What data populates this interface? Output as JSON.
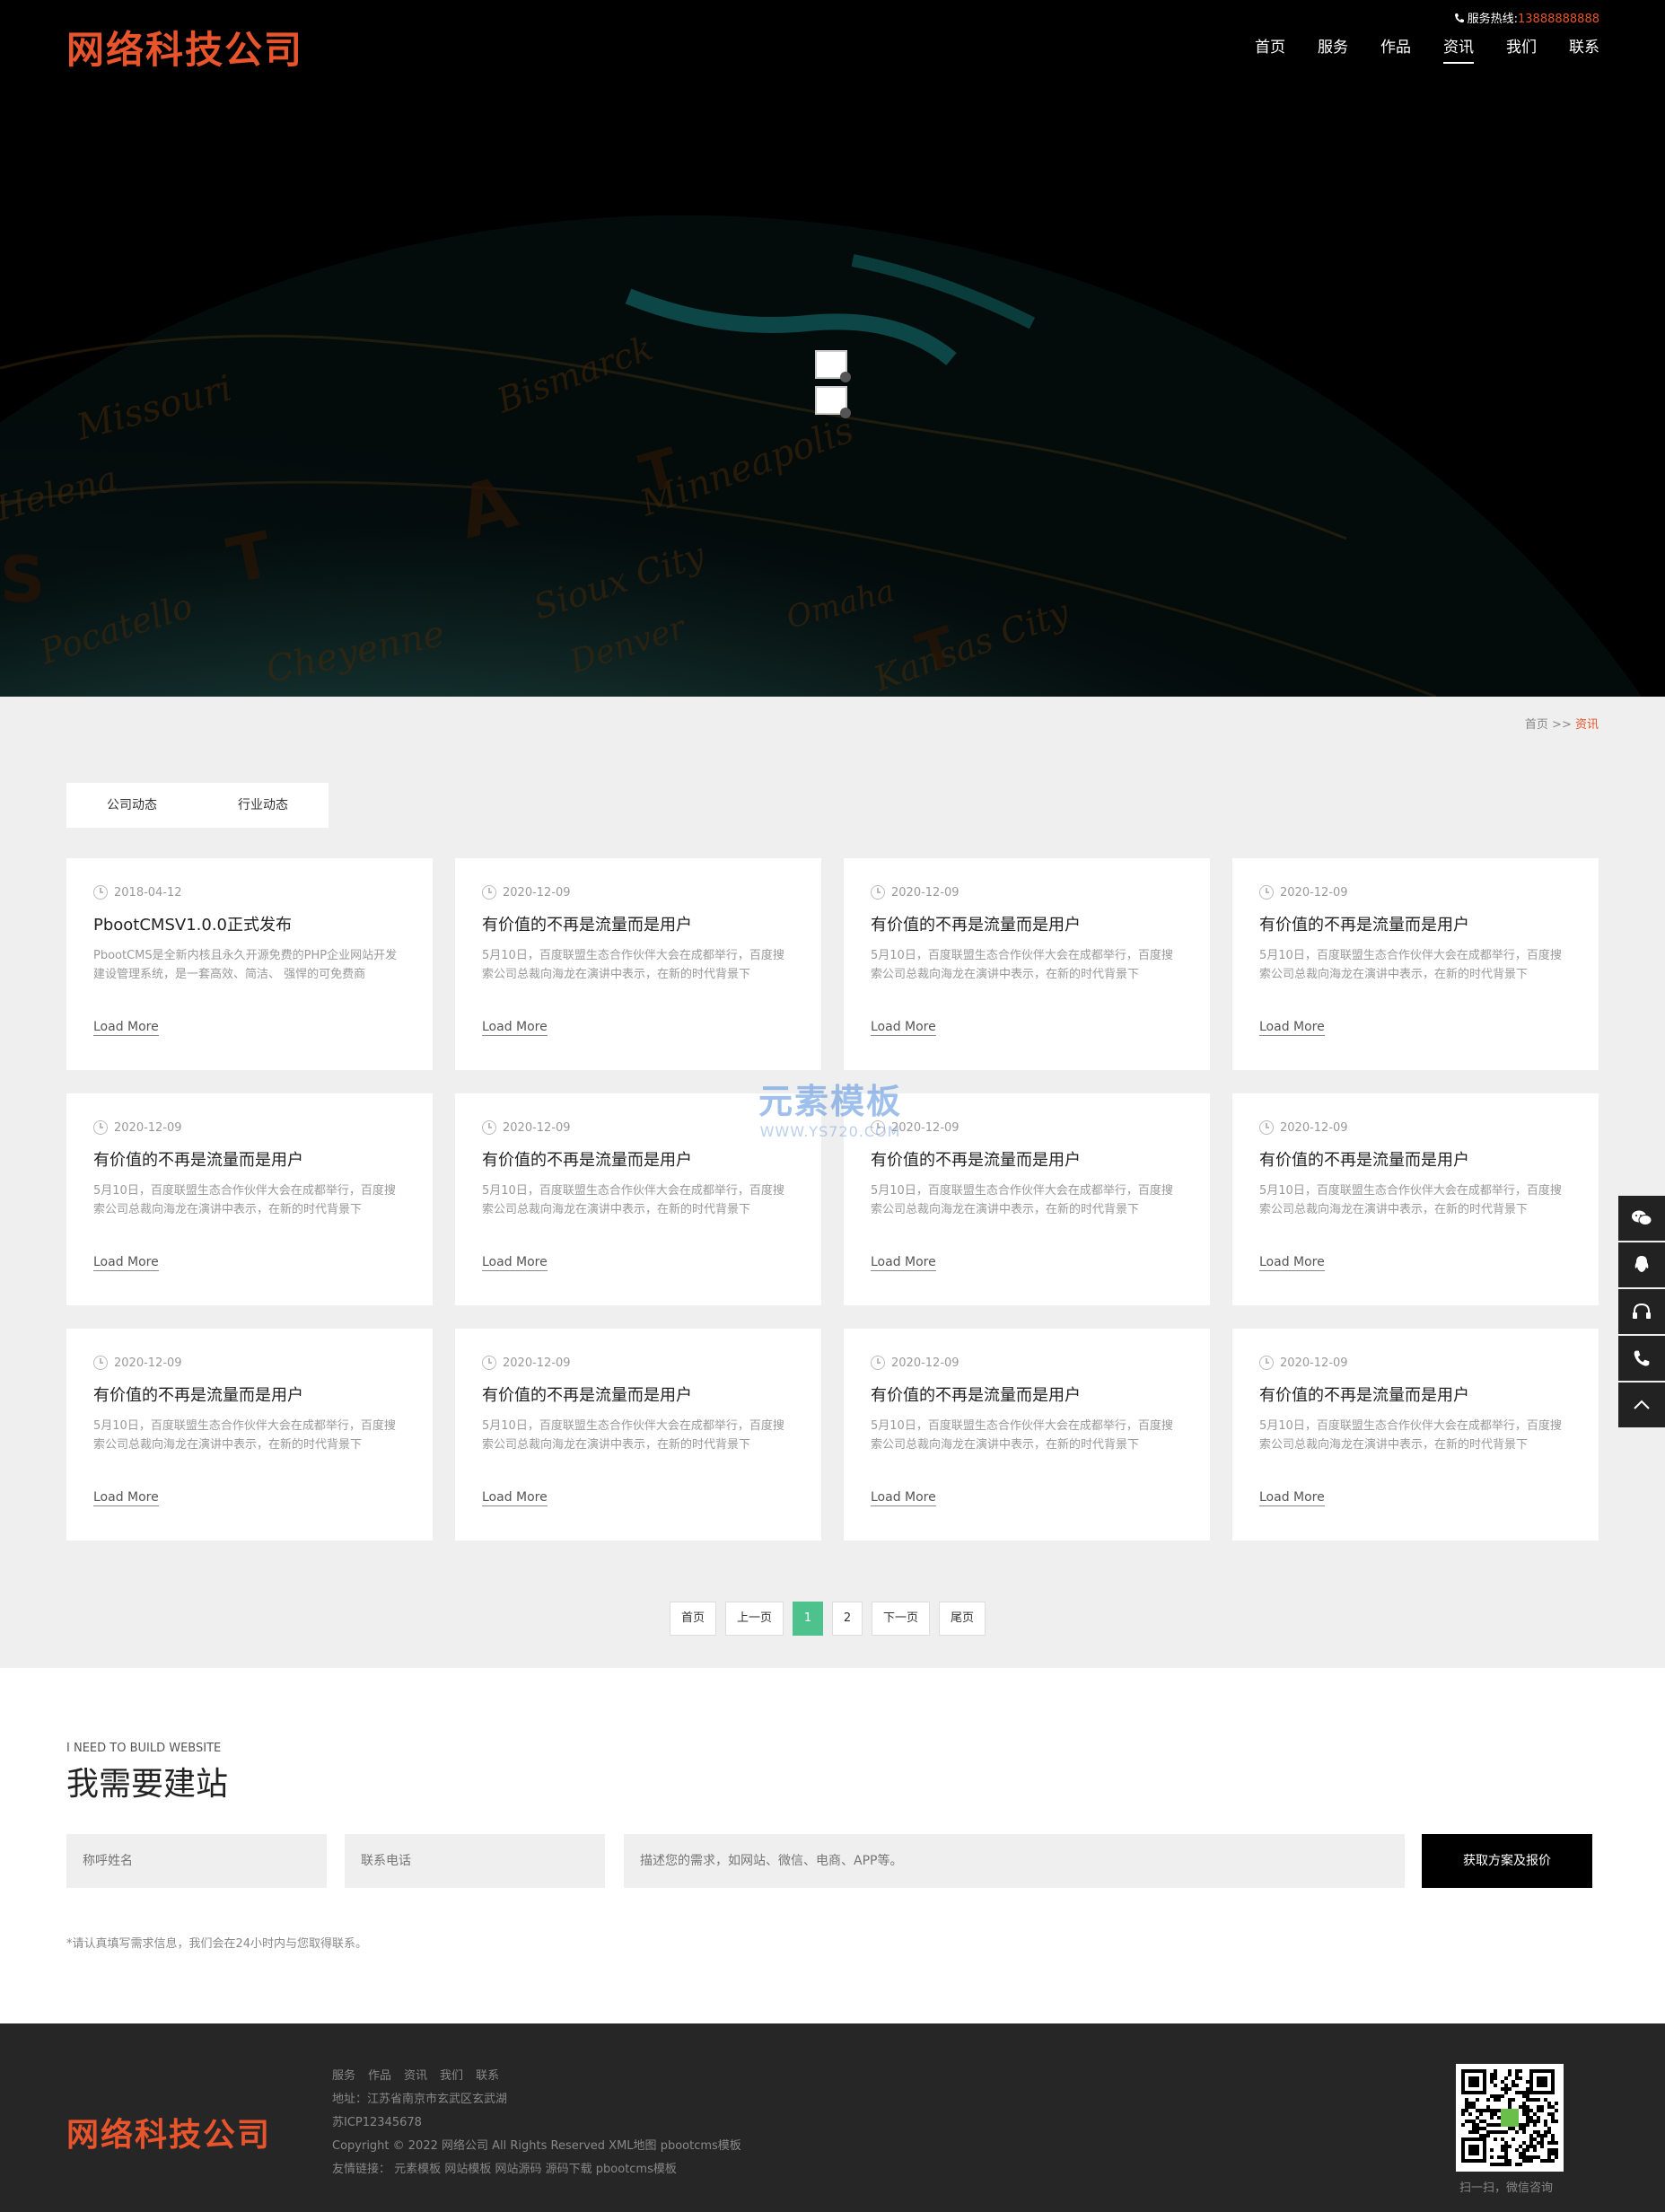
{
  "header": {
    "logo": "网络科技公司",
    "hotline_label": "服务热线:",
    "hotline_number": "13888888888",
    "nav": [
      "首页",
      "服务",
      "作品",
      "资讯",
      "我们",
      "联系"
    ],
    "active_nav": "资讯"
  },
  "breadcrumb": {
    "home": "首页",
    "sep": ">>",
    "current": "资讯"
  },
  "tabs": [
    "公司动态",
    "行业动态"
  ],
  "news": [
    {
      "date": "2018-04-12",
      "title": "PbootCMSV1.0.0正式发布",
      "desc": "PbootCMS是全新内核且永久开源免费的PHP企业网站开发建设管理系统，是一套高效、简洁、 强悍的可免费商",
      "more": "Load More"
    },
    {
      "date": "2020-12-09",
      "title": "有价值的不再是流量而是用户",
      "desc": "5月10日，百度联盟生态合作伙伴大会在成都举行，百度搜索公司总裁向海龙在演讲中表示，在新的时代背景下",
      "more": "Load More"
    },
    {
      "date": "2020-12-09",
      "title": "有价值的不再是流量而是用户",
      "desc": "5月10日，百度联盟生态合作伙伴大会在成都举行，百度搜索公司总裁向海龙在演讲中表示，在新的时代背景下",
      "more": "Load More"
    },
    {
      "date": "2020-12-09",
      "title": "有价值的不再是流量而是用户",
      "desc": "5月10日，百度联盟生态合作伙伴大会在成都举行，百度搜索公司总裁向海龙在演讲中表示，在新的时代背景下",
      "more": "Load More"
    },
    {
      "date": "2020-12-09",
      "title": "有价值的不再是流量而是用户",
      "desc": "5月10日，百度联盟生态合作伙伴大会在成都举行，百度搜索公司总裁向海龙在演讲中表示，在新的时代背景下",
      "more": "Load More"
    },
    {
      "date": "2020-12-09",
      "title": "有价值的不再是流量而是用户",
      "desc": "5月10日，百度联盟生态合作伙伴大会在成都举行，百度搜索公司总裁向海龙在演讲中表示，在新的时代背景下",
      "more": "Load More"
    },
    {
      "date": "2020-12-09",
      "title": "有价值的不再是流量而是用户",
      "desc": "5月10日，百度联盟生态合作伙伴大会在成都举行，百度搜索公司总裁向海龙在演讲中表示，在新的时代背景下",
      "more": "Load More"
    },
    {
      "date": "2020-12-09",
      "title": "有价值的不再是流量而是用户",
      "desc": "5月10日，百度联盟生态合作伙伴大会在成都举行，百度搜索公司总裁向海龙在演讲中表示，在新的时代背景下",
      "more": "Load More"
    },
    {
      "date": "2020-12-09",
      "title": "有价值的不再是流量而是用户",
      "desc": "5月10日，百度联盟生态合作伙伴大会在成都举行，百度搜索公司总裁向海龙在演讲中表示，在新的时代背景下",
      "more": "Load More"
    },
    {
      "date": "2020-12-09",
      "title": "有价值的不再是流量而是用户",
      "desc": "5月10日，百度联盟生态合作伙伴大会在成都举行，百度搜索公司总裁向海龙在演讲中表示，在新的时代背景下",
      "more": "Load More"
    },
    {
      "date": "2020-12-09",
      "title": "有价值的不再是流量而是用户",
      "desc": "5月10日，百度联盟生态合作伙伴大会在成都举行，百度搜索公司总裁向海龙在演讲中表示，在新的时代背景下",
      "more": "Load More"
    },
    {
      "date": "2020-12-09",
      "title": "有价值的不再是流量而是用户",
      "desc": "5月10日，百度联盟生态合作伙伴大会在成都举行，百度搜索公司总裁向海龙在演讲中表示，在新的时代背景下",
      "more": "Load More"
    }
  ],
  "watermark": {
    "line1": "元素模板",
    "line2": "WWW.YS720.COM"
  },
  "pagination": {
    "first": "首页",
    "prev": "上一页",
    "pages": [
      "1",
      "2"
    ],
    "current": "1",
    "next": "下一页",
    "last": "尾页"
  },
  "sidebar": {
    "icons": [
      "wechat-icon",
      "qq-icon",
      "headset-icon",
      "phone-icon",
      "back-to-top-icon"
    ]
  },
  "build": {
    "title_en": "I NEED TO BUILD WEBSITE",
    "title_cn": "我需要建站",
    "name_placeholder": "称呼姓名",
    "phone_placeholder": "联系电话",
    "desc_placeholder": "描述您的需求，如网站、微信、电商、APP等。",
    "submit": "获取方案及报价",
    "note": "*请认真填写需求信息，我们会在24小时内与您取得联系。"
  },
  "footer": {
    "logo": "网络科技公司",
    "links": [
      "服务",
      "作品",
      "资讯",
      "我们",
      "联系"
    ],
    "address": "地址：江苏省南京市玄武区玄武湖",
    "icp": "苏ICP12345678",
    "copyright": "Copyright © 2022 网络公司 All Rights Reserved",
    "xml_map": "XML地图",
    "pbootcms": "pbootcms模板",
    "friend_links_label": "友情链接：",
    "friend_links": [
      "元素模板",
      "网站模板",
      "网站源码",
      "源码下载",
      "pbootcms模板"
    ],
    "qr_caption": "扫一扫，微信咨询"
  },
  "colors": {
    "accent": "#e8542c",
    "page_active": "#4ec28d",
    "header_bg": "#000000",
    "footer_bg": "#262626"
  }
}
